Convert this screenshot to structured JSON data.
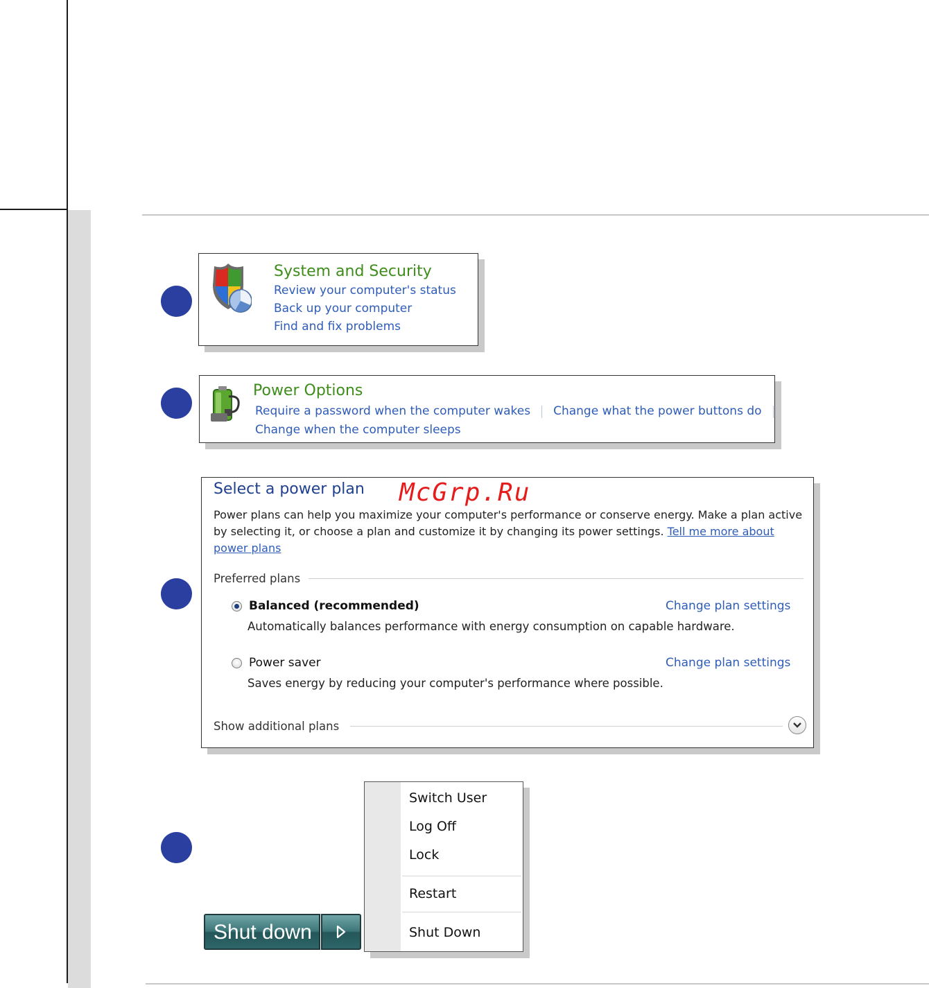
{
  "system_security": {
    "title": "System and Security",
    "links": [
      "Review your computer's status",
      "Back up your computer",
      "Find and fix problems"
    ]
  },
  "power_options": {
    "title": "Power Options",
    "links": [
      "Require a password when the computer wakes",
      "Change what the power buttons do",
      "Change when the computer sleeps"
    ]
  },
  "power_plan": {
    "heading": "Select a power plan",
    "description": "Power plans can help you maximize your computer's performance or conserve energy. Make a plan active by selecting it, or choose a plan and customize it by changing its power settings.",
    "help_link": "Tell me more about power plans",
    "preferred_label": "Preferred plans",
    "plans": [
      {
        "name": "Balanced (recommended)",
        "description": "Automatically balances performance with energy consumption on capable hardware.",
        "link": "Change plan settings",
        "selected": true
      },
      {
        "name": "Power saver",
        "description": "Saves energy by reducing your computer's performance where possible.",
        "link": "Change plan settings",
        "selected": false
      }
    ],
    "additional_label": "Show additional plans"
  },
  "watermark": "McGrp.Ru",
  "shutdown": {
    "button_label": "Shut down",
    "menu_items": [
      "Switch User",
      "Log Off",
      "Lock",
      "Restart",
      "Shut Down"
    ]
  }
}
